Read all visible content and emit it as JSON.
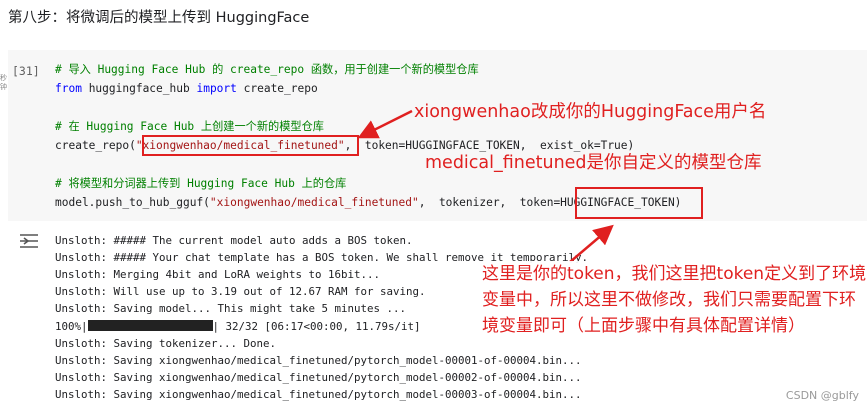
{
  "heading": "第八步：将微调后的模型上传到 HuggingFace",
  "cell": {
    "exec_count": "[31]",
    "side_hint": "秒钟",
    "code": {
      "c1": "# 导入 Hugging Face Hub 的 create_repo 函数，用于创建一个新的模型仓库",
      "l2_kw1": "from",
      "l2_mod": " huggingface_hub ",
      "l2_kw2": "import",
      "l2_fn": " create_repo",
      "c4": "# 在 Hugging Face Hub 上创建一个新的模型仓库",
      "l5_pre": "create_repo(",
      "l5_str": "\"xiongwenhao/medical_finetuned\"",
      "l5_post": ",  token=HUGGINGFACE_TOKEN,  exist_ok=True)",
      "c7": "# 将模型和分词器上传到 Hugging Face Hub 上的仓库",
      "l8_pre": "model.push_to_hub_gguf(",
      "l8_str": "\"xiongwenhao/medical_finetuned\"",
      "l8_post": ",  tokenizer,  token=HUGGINGFACE_TOKEN)"
    }
  },
  "output_lines": [
    "Unsloth: ##### The current model auto adds a BOS token.",
    "Unsloth: ##### Your chat template has a BOS token. We shall remove it temporarily.",
    "Unsloth: Merging 4bit and LoRA weights to 16bit...",
    "Unsloth: Will use up to 3.19 out of 12.67 RAM for saving.",
    "Unsloth: Saving model... This might take 5 minutes ...",
    "Unsloth: Saving tokenizer... Done.",
    "Unsloth: Saving xiongwenhao/medical_finetuned/pytorch_model-00001-of-00004.bin...",
    "Unsloth: Saving xiongwenhao/medical_finetuned/pytorch_model-00002-of-00004.bin...",
    "Unsloth: Saving xiongwenhao/medical_finetuned/pytorch_model-00003-of-00004.bin..."
  ],
  "progress": {
    "percent_label": "100%|",
    "fraction": 1.0,
    "tail": "| 32/32 [06:17<00:00, 11.79s/it]"
  },
  "annotations": {
    "username": "xiongwenhao改成你的HuggingFace用户名",
    "repo": "medical_finetuned是你自定义的模型仓库",
    "token": "这里是你的token，我们这里把token定义到了环境变量中，所以这里不做修改，我们只需要配置下环境变量即可（上面步骤中有具体配置详情）"
  },
  "watermark": "CSDN @gblfy",
  "colors": {
    "annotation": "#e02020",
    "comment": "#008000",
    "keyword": "#0000ff",
    "string": "#a31515"
  }
}
